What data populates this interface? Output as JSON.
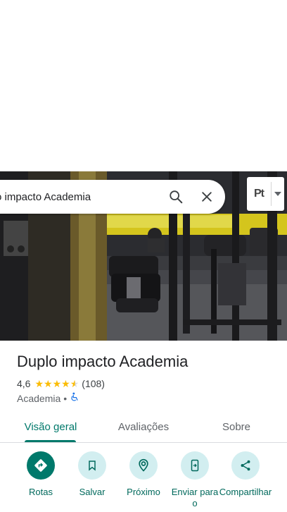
{
  "search": {
    "query": "o impacto Academia"
  },
  "lang_chip": {
    "label": "Pt"
  },
  "place": {
    "name": "Duplo impacto Academia",
    "rating": "4,6",
    "review_count": "(108)",
    "category": "Academia",
    "separator": "•"
  },
  "tabs": [
    {
      "label": "Visão geral",
      "active": true
    },
    {
      "label": "Avaliações",
      "active": false
    },
    {
      "label": "Sobre",
      "active": false
    }
  ],
  "actions": [
    {
      "label": "Rotas",
      "icon": "directions-icon"
    },
    {
      "label": "Salvar",
      "icon": "bookmark-icon"
    },
    {
      "label": "Próximo",
      "icon": "nearby-icon"
    },
    {
      "label": "Enviar para o",
      "icon": "send-to-phone-icon"
    },
    {
      "label": "Compartilhar",
      "icon": "share-icon"
    }
  ],
  "colors": {
    "accent": "#00796b",
    "action_bg": "#d2eef0",
    "star": "#fbbc04"
  }
}
